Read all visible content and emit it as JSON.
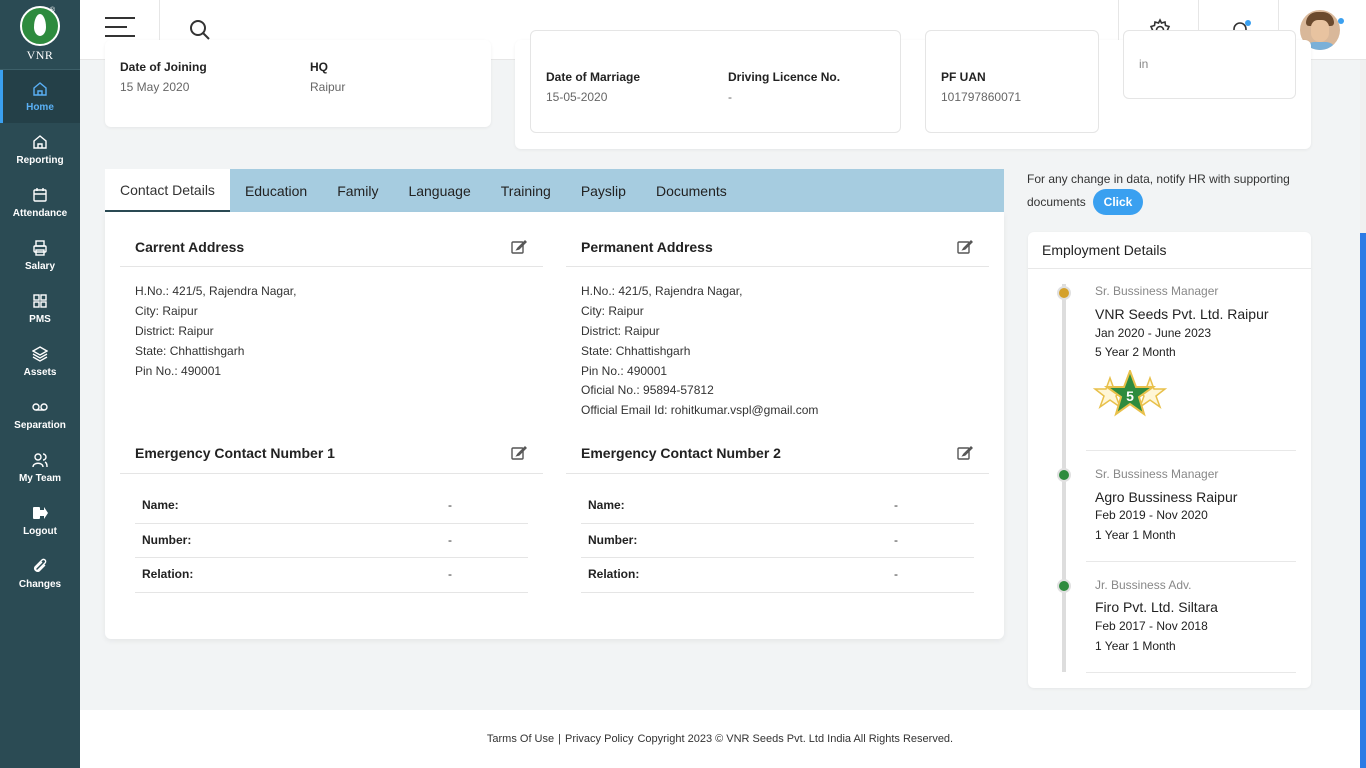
{
  "brand": {
    "name": "VNR",
    "reg": "®"
  },
  "sidebar": {
    "items": [
      {
        "label": "Home",
        "icon": "home-icon"
      },
      {
        "label": "Reporting",
        "icon": "home-icon"
      },
      {
        "label": "Attendance",
        "icon": "calendar-icon"
      },
      {
        "label": "Salary",
        "icon": "printer-icon"
      },
      {
        "label": "PMS",
        "icon": "grid-icon"
      },
      {
        "label": "Assets",
        "icon": "layers-icon"
      },
      {
        "label": "Separation",
        "icon": "voicemail-icon"
      },
      {
        "label": "My Team",
        "icon": "users-icon"
      },
      {
        "label": "Logout",
        "icon": "logout-icon"
      },
      {
        "label": "Changes",
        "icon": "paperclip-icon"
      }
    ],
    "active": "Home"
  },
  "profile_top": {
    "date_of_joining_label": "Date of Joining",
    "date_of_joining": "15 May 2020",
    "hq_label": "HQ",
    "hq": "Raipur",
    "date_of_marriage_label": "Date of Marriage",
    "date_of_marriage": "15-05-2020",
    "driving_licence_label": "Driving Licence No.",
    "driving_licence": "-",
    "pf_uan_label": "PF UAN",
    "pf_uan": "101797860071",
    "partial_text": "in"
  },
  "tabs": [
    "Contact Details",
    "Education",
    "Family",
    "Language",
    "Training",
    "Payslip",
    "Documents"
  ],
  "contact": {
    "current_title": "Carrent Address",
    "current_lines": [
      "H.No.: 421/5, Rajendra Nagar,",
      "City: Raipur",
      "District: Raipur",
      "State: Chhattishgarh",
      "Pin No.: 490001"
    ],
    "permanent_title": "Permanent Address",
    "permanent_lines": [
      "H.No.: 421/5, Rajendra Nagar,",
      "City: Raipur",
      "District: Raipur",
      "State: Chhattishgarh",
      "Pin No.: 490001",
      "Oficial No.: 95894-57812",
      "Official Email Id: rohitkumar.vspl@gmail.com"
    ],
    "emergency1_title": "Emergency Contact Number 1",
    "emergency2_title": "Emergency Contact Number 2",
    "emergency1_rows": [
      {
        "label": "Name:",
        "value": "-"
      },
      {
        "label": "Number:",
        "value": "-"
      },
      {
        "label": "Relation:",
        "value": "-"
      }
    ],
    "emergency2_rows": [
      {
        "label": "Name:",
        "value": "-"
      },
      {
        "label": "Number:",
        "value": "-"
      },
      {
        "label": "Relation:",
        "value": "-"
      }
    ]
  },
  "notice": {
    "text": "For any change in data, notify HR with supporting documents",
    "button": "Click"
  },
  "employment": {
    "title": "Employment Details",
    "entries": [
      {
        "role": "Sr. Bussiness Manager",
        "company": "VNR Seeds Pvt. Ltd. Raipur",
        "dates": "Jan 2020 - June 2023",
        "duration": "5 Year 2 Month",
        "badge": "5",
        "dot_color": "#d4a12c"
      },
      {
        "role": "Sr. Bussiness Manager",
        "company": "Agro Bussiness Raipur",
        "dates": "Feb 2019 - Nov 2020",
        "duration": "1 Year 1 Month",
        "dot_color": "#2e8b3e"
      },
      {
        "role": "Jr. Bussiness Adv.",
        "company": "Firo Pvt. Ltd. Siltara",
        "dates": "Feb 2017 - Nov 2018",
        "duration": "1 Year 1 Month",
        "dot_color": "#2e8b3e"
      }
    ]
  },
  "footer": {
    "terms": "Tarms Of Use",
    "divider": "|",
    "privacy": "Privacy Policy",
    "copyright": "Copyright 2023 © VNR Seeds Pvt. Ltd India All Rights Reserved."
  }
}
